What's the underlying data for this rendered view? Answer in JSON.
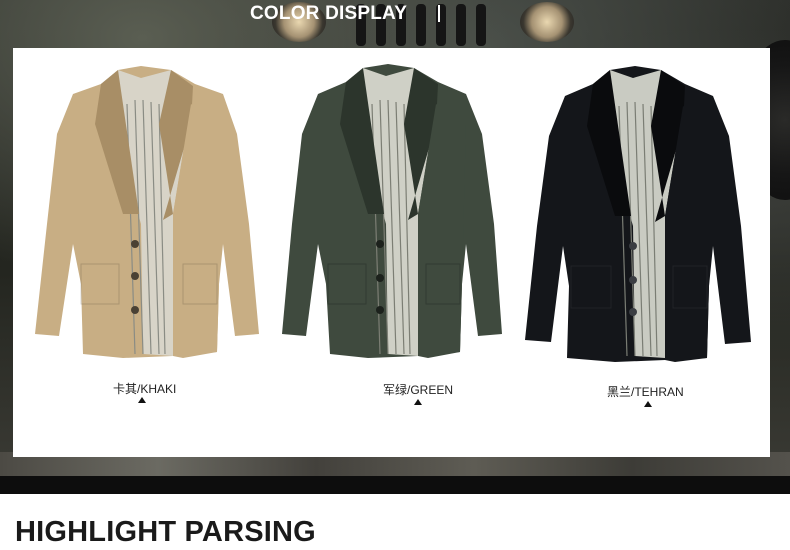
{
  "header": {
    "title": "COLOR DISPLAY"
  },
  "products": [
    {
      "caption": "卡其/KHAKI",
      "body_color": "#c8ae84",
      "shade_color": "#a88e66"
    },
    {
      "caption": "军绿/GREEN",
      "body_color": "#3f4a3e",
      "shade_color": "#2c352c"
    },
    {
      "caption": "黑兰/TEHRAN",
      "body_color": "#14161a",
      "shade_color": "#0a0b0d"
    }
  ],
  "section": {
    "title": "HIGHLIGHT PARSING"
  }
}
